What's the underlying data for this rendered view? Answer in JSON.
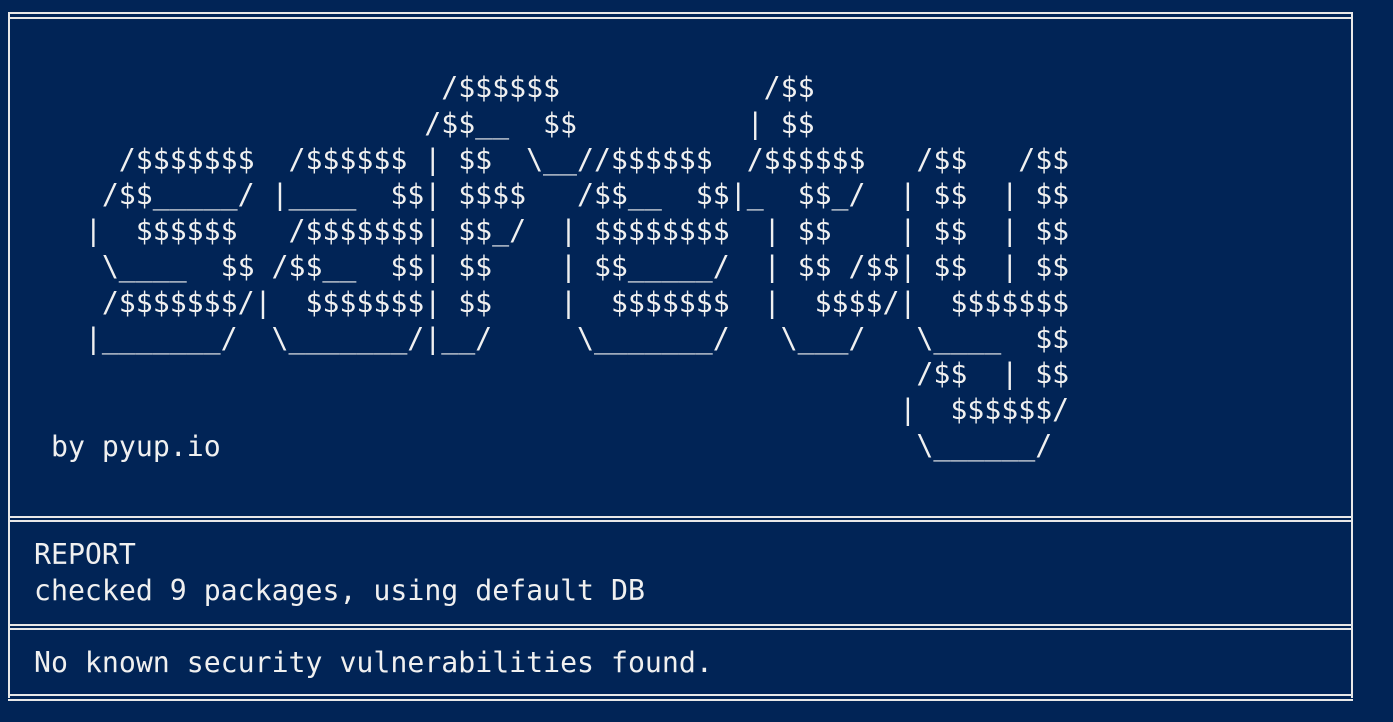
{
  "banner": {
    "ascii_lines": [
      "                       /$$$$$$            /$$",
      "                      /$$__  $$          | $$",
      "    /$$$$$$$  /$$$$$$ | $$  \\__//$$$$$$  /$$$$$$   /$$   /$$",
      "   /$$_____/ |____  $$| $$$$   /$$__  $$|_  $$_/  | $$  | $$",
      "  |  $$$$$$   /$$$$$$$| $$_/  | $$$$$$$$  | $$    | $$  | $$",
      "   \\____  $$ /$$__  $$| $$    | $$_____/  | $$ /$$| $$  | $$",
      "   /$$$$$$$/|  $$$$$$$| $$    |  $$$$$$$  |  $$$$/|  $$$$$$$",
      "  |_______/  \\_______/|__/     \\_______/   \\___/   \\____  $$",
      "                                                   /$$  | $$",
      "                                                  |  $$$$$$/",
      "                                                   \\______/"
    ],
    "byline": "by pyup.io"
  },
  "report": {
    "title": "REPORT",
    "summary": "checked 9 packages, using default DB"
  },
  "result": {
    "message": "No known security vulnerabilities found."
  },
  "colors": {
    "background": "#012456",
    "foreground": "#f0f0f0",
    "border": "#e8e8e8"
  }
}
